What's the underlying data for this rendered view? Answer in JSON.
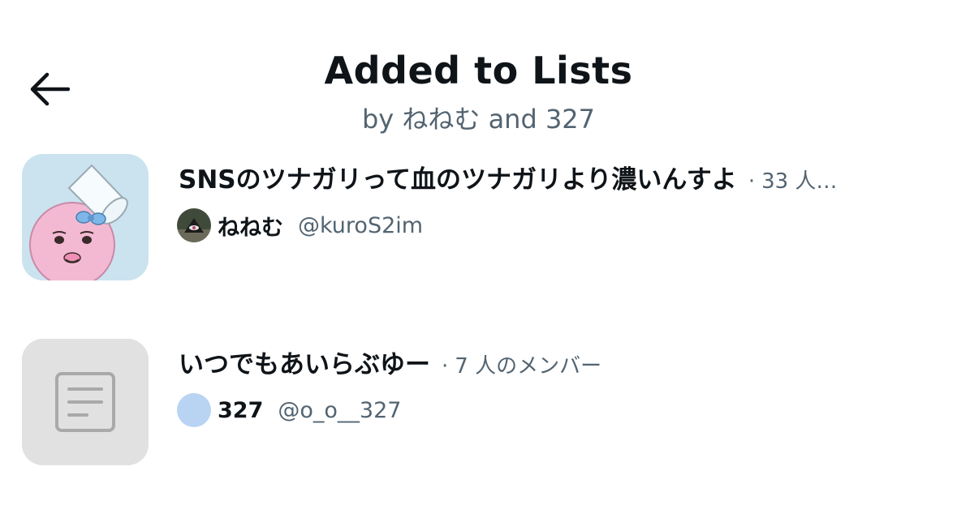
{
  "header": {
    "title": "Added to Lists",
    "subtitle": "by ねねむ and 327"
  },
  "lists": [
    {
      "name": "SNSのツナガリって血のツナガリより濃いんすよ",
      "separator": "·",
      "members": "33 人…",
      "owner_name": "ねねむ",
      "owner_handle": "@kuroS2im",
      "thumb_icon": "pink-character-with-cup-hat",
      "owner_avatar_icon": "dark-character-avatar"
    },
    {
      "name": "いつでもあいらぶゆー",
      "separator": "·",
      "members": "7 人のメンバー",
      "owner_name": "327",
      "owner_handle": "@o_o__327",
      "thumb_icon": "document-list-icon",
      "owner_avatar_icon": "blue-circle-avatar"
    }
  ],
  "colors": {
    "text_primary": "#0f1419",
    "text_secondary": "#536471",
    "placeholder_bg": "#e1e1e1",
    "thumb_sky": "#cbe3ef",
    "avatar_blue": "#b9d4f3"
  }
}
